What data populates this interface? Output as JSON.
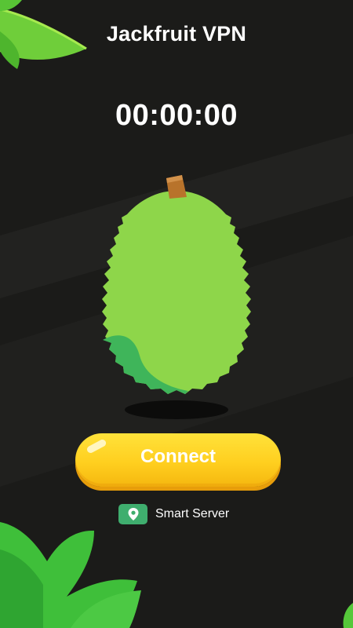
{
  "app": {
    "title": "Jackfruit VPN"
  },
  "timer": {
    "elapsed": "00:00:00"
  },
  "connect": {
    "label": "Connect"
  },
  "server": {
    "label": "Smart Server",
    "icon": "location-pin-icon"
  },
  "colors": {
    "background": "#1b1b19",
    "fruit": "#8ed64a",
    "accent_button": "#ffcf1f",
    "server_icon_bg": "#3fae6e"
  }
}
